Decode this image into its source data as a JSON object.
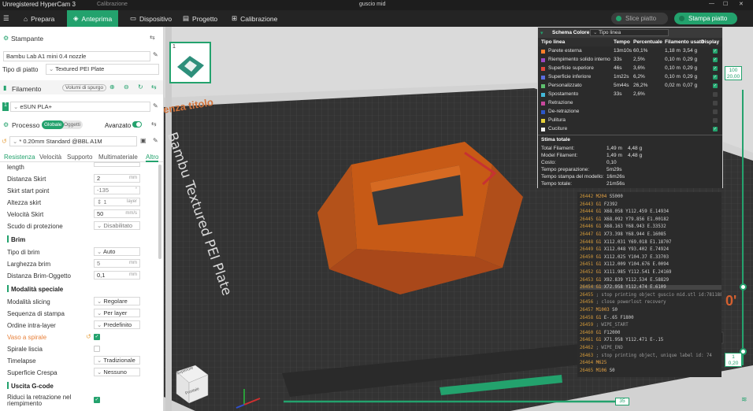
{
  "titlebar": {
    "app": "Unregistered HyperCam 3",
    "menu": "Calibrazione",
    "file": "guscio mid"
  },
  "nav": {
    "prepare": "Prepara",
    "preview": "Anteprima",
    "device": "Dispositivo",
    "project": "Progetto",
    "calibration": "Calibrazione"
  },
  "actions": {
    "slice": "Slice piatto",
    "print": "Stampa piatto"
  },
  "printer": {
    "section": "Stampante",
    "name": "Bambu Lab A1 mini 0.4 nozzle",
    "plate_label": "Tipo di piatto",
    "plate_value": "Textured PEI Plate"
  },
  "filament": {
    "section": "Filamento",
    "purge": "Volumi di spurgo",
    "slot": "1",
    "name": "eSUN PLA+"
  },
  "process": {
    "section": "Processo",
    "global": "Globale",
    "objects": "Oggetti",
    "advanced": "Avanzato",
    "profile": "* 0.20mm Standard @BBL A1M"
  },
  "tabs": [
    "Resistenza",
    "Velocità",
    "Supporto",
    "Multimateriale",
    "Altro"
  ],
  "settings": {
    "length_label": "length",
    "skirt_distance": {
      "label": "Distanza Skirt",
      "value": "2",
      "unit": "mm"
    },
    "skirt_start": {
      "label": "Skirt start point",
      "value": "-135",
      "unit": "°"
    },
    "skirt_height": {
      "label": "Altezza skirt",
      "value": "1",
      "unit": "layer"
    },
    "skirt_speed": {
      "label": "Velocità Skirt",
      "value": "50",
      "unit": "mm/s"
    },
    "draft_shield": {
      "label": "Scudo di protezione",
      "value": "Disabilitato"
    },
    "brim_section": "Brim",
    "brim_type": {
      "label": "Tipo di brim",
      "value": "Auto"
    },
    "brim_width": {
      "label": "Larghezza brim",
      "value": "5",
      "unit": "mm"
    },
    "brim_gap": {
      "label": "Distanza Brim-Oggetto",
      "value": "0,1",
      "unit": "mm"
    },
    "special_section": "Modalità speciale",
    "slicing_mode": {
      "label": "Modalità slicing",
      "value": "Regolare"
    },
    "print_sequence": {
      "label": "Sequenza di stampa",
      "value": "Per layer"
    },
    "layer_order": {
      "label": "Ordine intra-layer",
      "value": "Predefinito"
    },
    "spiral_vase": {
      "label": "Vaso a spirale"
    },
    "smooth_spiral": {
      "label": "Spirale liscia"
    },
    "timelapse": {
      "label": "Timelapse",
      "value": "Tradizionale"
    },
    "fuzzy_skin": {
      "label": "Superficie Crespa",
      "value": "Nessuno"
    },
    "gcode_section": "Uscita G-code",
    "reduce_retract": {
      "label": "Riduci la retrazione nel riempimento"
    }
  },
  "viewport": {
    "plate_number": "1",
    "plate_title": "enza titolo",
    "plate_text": "Bambu Textured PEI Plate",
    "cube_top": "Superiore",
    "cube_front": "Frontale",
    "slider_top": "100",
    "slider_top_height": "20,00",
    "slider_bottom": "1",
    "slider_bottom_height": "0,20",
    "slider_h": "35",
    "side_text": "0'"
  },
  "legend": {
    "title": "Schema Colore",
    "mode": "Tipo linea",
    "columns": [
      "Tipo linea",
      "Tempo",
      "Percentuale",
      "Filamento usato",
      "Display"
    ],
    "rows": [
      {
        "name": "Parete esterna",
        "time": "13m10s",
        "pct": "60,1%",
        "len": "1,18 m",
        "wt": "3,54 g",
        "color": "#ff7f2a",
        "shown": true
      },
      {
        "name": "Riempimento solido interno",
        "time": "33s",
        "pct": "2,5%",
        "len": "0,10 m",
        "wt": "0,29 g",
        "color": "#9b48c4",
        "shown": true
      },
      {
        "name": "Superficie superiore",
        "time": "46s",
        "pct": "3,6%",
        "len": "0,10 m",
        "wt": "0,29 g",
        "color": "#e0463c",
        "shown": true
      },
      {
        "name": "Superficie inferiore",
        "time": "1m22s",
        "pct": "6,2%",
        "len": "0,10 m",
        "wt": "0,29 g",
        "color": "#5a6de0",
        "shown": true
      },
      {
        "name": "Personalizzato",
        "time": "5m44s",
        "pct": "26,2%",
        "len": "0,02 m",
        "wt": "0,07 g",
        "color": "#5ebf6e",
        "shown": true
      },
      {
        "name": "Spostamento",
        "time": "33s",
        "pct": "2,6%",
        "len": "",
        "wt": "",
        "color": "#43b8d8",
        "shown": false
      },
      {
        "name": "Retrazione",
        "time": "",
        "pct": "",
        "len": "",
        "wt": "",
        "color": "#c8489c",
        "shown": false
      },
      {
        "name": "De-retrazione",
        "time": "",
        "pct": "",
        "len": "",
        "wt": "",
        "color": "#2c57c7",
        "shown": false
      },
      {
        "name": "Pulitura",
        "time": "",
        "pct": "",
        "len": "",
        "wt": "",
        "color": "#e7d03a",
        "shown": false
      },
      {
        "name": "Cuciture",
        "time": "",
        "pct": "",
        "len": "",
        "wt": "",
        "color": "#f2f2f2",
        "shown": true
      }
    ],
    "estimate_title": "Stima totale",
    "estimates": [
      {
        "label": "Total Filament:",
        "a": "1,49 m",
        "b": "4,48 g"
      },
      {
        "label": "Model Filament:",
        "a": "1,49 m",
        "b": "4,48 g"
      },
      {
        "label": "Costo:",
        "a": "0,10",
        "b": ""
      },
      {
        "label": "Tempo preparazione:",
        "a": "5m29s",
        "b": ""
      },
      {
        "label": "Tempo stampa del modello:",
        "a": "16m26s",
        "b": ""
      },
      {
        "label": "Tempo totale:",
        "a": "21m56s",
        "b": ""
      }
    ]
  },
  "gcode": [
    {
      "n": "26442",
      "c": "M204",
      "a": "S5000"
    },
    {
      "n": "26443",
      "c": "G1",
      "a": "F2392"
    },
    {
      "n": "26444",
      "c": "G1",
      "a": "X68.058 Y112.459 E.14934"
    },
    {
      "n": "26445",
      "c": "G1",
      "a": "X68.092 Y79.856 E1.00182"
    },
    {
      "n": "26446",
      "c": "G1",
      "a": "X68.163 Y68.943 E.33532"
    },
    {
      "n": "26447",
      "c": "G1",
      "a": "X73.398 Y68.944 E.16085"
    },
    {
      "n": "26448",
      "c": "G1",
      "a": "X112.031 Y69.018 E1.18707"
    },
    {
      "n": "26449",
      "c": "G1",
      "a": "X112.048 Y93.402 E.74924"
    },
    {
      "n": "26450",
      "c": "G1",
      "a": "X112.025 Y104.37 E.33703"
    },
    {
      "n": "26451",
      "c": "G1",
      "a": "X112.009 Y104.676 E.0094"
    },
    {
      "n": "26452",
      "c": "G1",
      "a": "X111.985 Y112.541 E.24169"
    },
    {
      "n": "26453",
      "c": "G1",
      "a": "X92.839 Y112.534 E.58829"
    },
    {
      "n": "26454",
      "c": "G1",
      "a": "X72.958 Y112.474 E.6109"
    },
    {
      "n": "26455",
      "c": "",
      "a": "; stop printing object guscio mid.stl id:78118875886"
    },
    {
      "n": "26456",
      "c": "",
      "a": "; close powerlost recovery"
    },
    {
      "n": "26457",
      "c": "M1003",
      "a": "S0"
    },
    {
      "n": "26458",
      "c": "G1",
      "a": "E-.65 F1800"
    },
    {
      "n": "26459",
      "c": "",
      "a": "; WIPE_START"
    },
    {
      "n": "26460",
      "c": "G1",
      "a": "F12000"
    },
    {
      "n": "26461",
      "c": "G1",
      "a": "X71.958 Y112.471 E-.15"
    },
    {
      "n": "26462",
      "c": "",
      "a": "; WIPE_END"
    },
    {
      "n": "26463",
      "c": "",
      "a": "; stop printing object, unique label id: 74"
    },
    {
      "n": "26464",
      "c": "M625",
      "a": ""
    },
    {
      "n": "26465",
      "c": "M106",
      "a": "S0"
    }
  ],
  "colors": {
    "accent": "#23a26d",
    "model": "#c75a16",
    "bed": "#3a3a3a"
  }
}
